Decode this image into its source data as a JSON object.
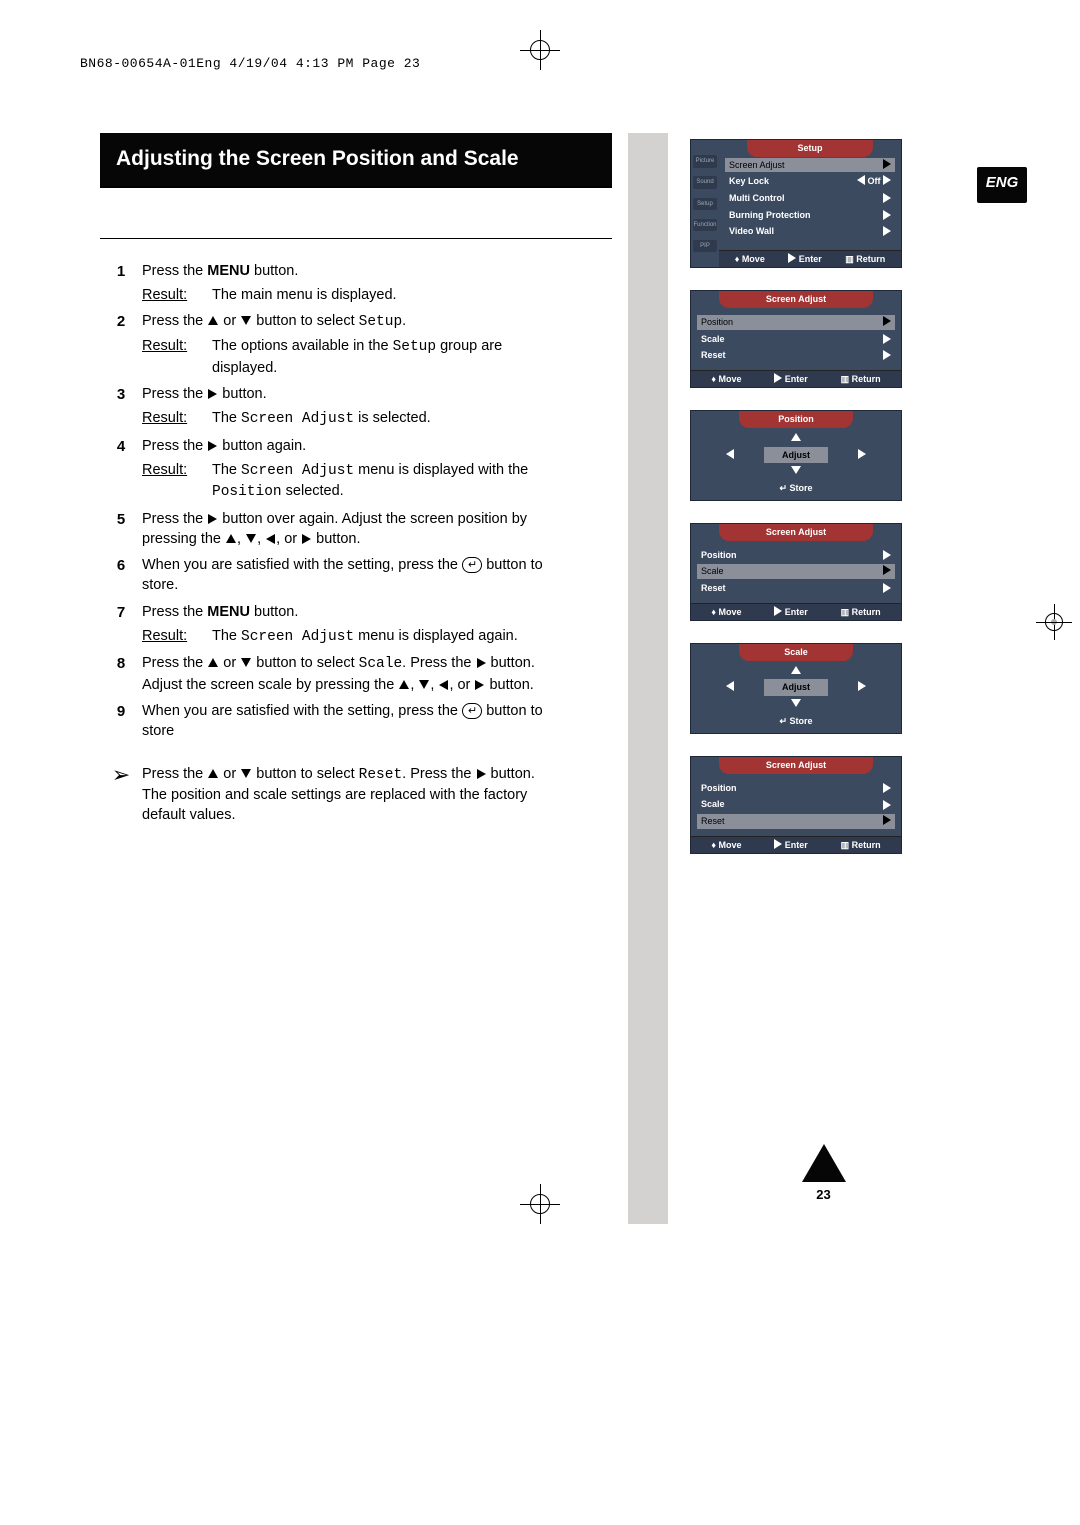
{
  "header_crop": "BN68-00654A-01Eng  4/19/04  4:13 PM  Page 23",
  "lang_badge": "ENG",
  "title": "Adjusting the Screen Position and Scale",
  "page_number": "23",
  "result_label": "Result:",
  "steps": {
    "s1": {
      "n": "1",
      "t": "Press the ",
      "b": "MENU",
      "t2": " button.",
      "r": "The main menu is displayed."
    },
    "s2": {
      "n": "2",
      "t1": "Press the ",
      "t2": " or ",
      "t3": " button to select ",
      "code": "Setup",
      "t4": ".",
      "r1": "The options available in the ",
      "rcode": "Setup",
      "r2": " group are displayed."
    },
    "s3": {
      "n": "3",
      "t1": "Press the ",
      "t2": " button.",
      "r1": "The ",
      "rcode": "Screen Adjust",
      "r2": " is selected."
    },
    "s4": {
      "n": "4",
      "t1": "Press the ",
      "t2": " button again.",
      "r1": "The ",
      "rcode": "Screen Adjust",
      "r2": " menu is displayed with the ",
      "rcode2": "Position",
      "r3": " selected."
    },
    "s5": {
      "n": "5",
      "t1": "Press the ",
      "t2": " button over again. Adjust the screen position by pressing the ",
      "t3": ", ",
      "t4": ", ",
      "t5": ", or ",
      "t6": " button."
    },
    "s6": {
      "n": "6",
      "t1": "When you are satisfied with the setting, press the ",
      "t2": " button to store."
    },
    "s7": {
      "n": "7",
      "t1": "Press the ",
      "b": "MENU",
      "t2": " button.",
      "r1": "The ",
      "rcode": "Screen Adjust",
      "r2": " menu is displayed again."
    },
    "s8": {
      "n": "8",
      "t1": "Press the ",
      "t2": " or ",
      "t3": " button to select ",
      "code": "Scale",
      "t4": ". Press the ",
      "t5": " button. Adjust the screen scale by pressing the ",
      "t6": ", ",
      "t7": ", ",
      "t8": ", or ",
      "t9": " button."
    },
    "s9": {
      "n": "9",
      "t1": "When you are satisfied with the setting, press the ",
      "t2": " button to store"
    }
  },
  "note": {
    "t1": "Press the ",
    "t2": " or ",
    "t3": " button to select ",
    "code": "Reset",
    "t4": ". Press the ",
    "t5": " button. The position and scale settings are replaced with the factory default values."
  },
  "osd": {
    "setup": {
      "title": "Setup",
      "items": [
        "Screen Adjust",
        "Key Lock",
        "Multi Control",
        "Burning Protection",
        "Video Wall"
      ],
      "keylock_val": "Off",
      "tabs": [
        "Picture",
        "Sound",
        "Setup",
        "Function",
        "PIP"
      ],
      "foot": {
        "move": "Move",
        "enter": "Enter",
        "ret": "Return"
      }
    },
    "sa": {
      "title": "Screen Adjust",
      "items": [
        "Position",
        "Scale",
        "Reset"
      ],
      "foot": {
        "move": "Move",
        "enter": "Enter",
        "ret": "Return"
      }
    },
    "pos": {
      "title": "Position",
      "adjust": "Adjust",
      "store": "Store"
    },
    "scale": {
      "title": "Scale",
      "adjust": "Adjust",
      "store": "Store"
    }
  }
}
